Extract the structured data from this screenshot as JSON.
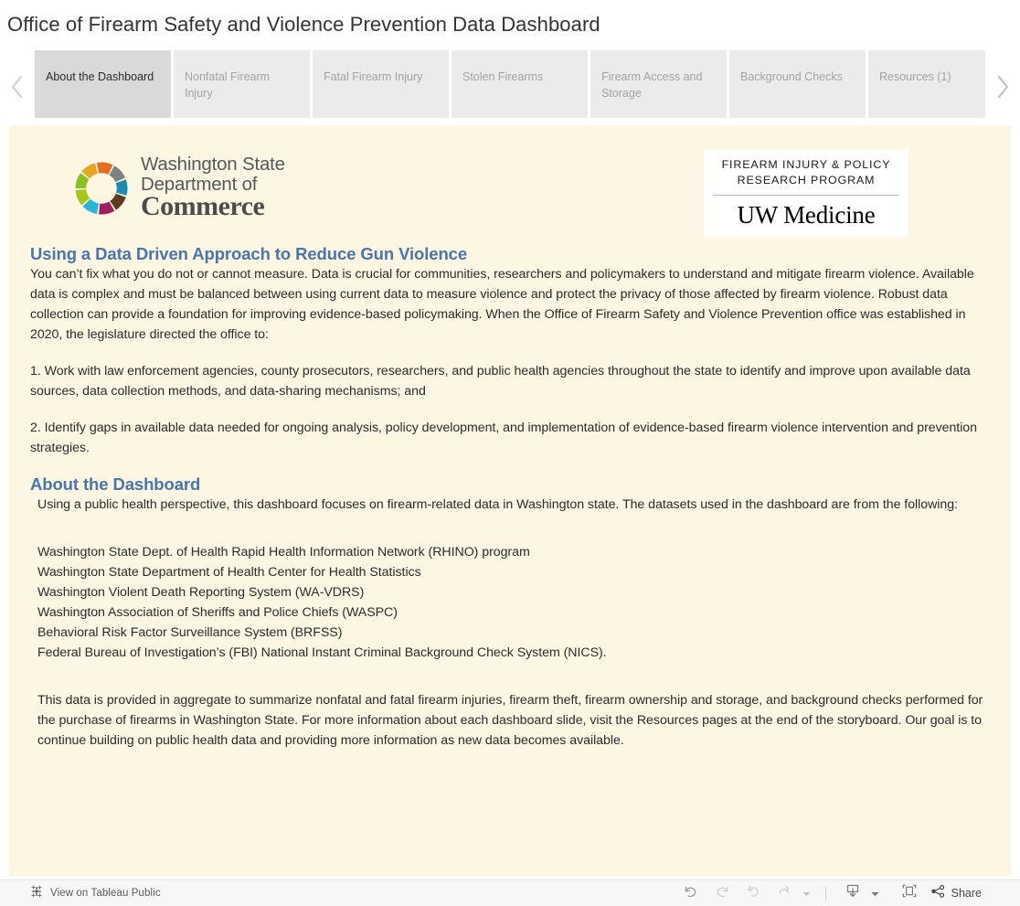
{
  "header": {
    "title": "Office of Firearm Safety and Violence Prevention Data Dashboard"
  },
  "tabstrip": {
    "prev_icon": "chevron-left-icon",
    "next_icon": "chevron-right-icon",
    "tabs": [
      {
        "label": "About the Dashboard",
        "active": true
      },
      {
        "label": "Nonfatal Firearm Injury",
        "active": false
      },
      {
        "label": "Fatal Firearm Injury",
        "active": false
      },
      {
        "label": "Stolen Firearms",
        "active": false
      },
      {
        "label": "Firearm Access and Storage",
        "active": false
      },
      {
        "label": "Background Checks",
        "active": false
      },
      {
        "label": "Resources (1)",
        "active": false
      }
    ]
  },
  "logos": {
    "commerce": {
      "icon": "commerce-pinwheel-logo",
      "line1": "Washington State",
      "line2": "Department of",
      "line3": "Commerce",
      "colors": [
        "#a8c61c",
        "#e2a71e",
        "#ea6a1c",
        "#7f8285",
        "#1b8cad",
        "#5b3a1e",
        "#a01b62",
        "#29b6d8",
        "#8cbf26"
      ]
    },
    "uw": {
      "top_line1": "FIREARM INJURY & POLICY",
      "top_line2": "RESEARCH PROGRAM",
      "bottom": "UW Medicine"
    }
  },
  "main": {
    "heading": "Using a Data Driven Approach to Reduce Gun Violence",
    "intro": "You can’t fix what you do not or cannot measure. Data is crucial for communities, researchers and policymakers to understand and mitigate firearm violence. Available data is complex and must be balanced between using current data to measure violence and protect the privacy of those affected by firearm violence. Robust data collection can provide a foundation for improving evidence-based policymaking. When the Office of Firearm Safety and Violence Prevention office was established in 2020, the legislature directed the office to:",
    "directive_1": "1. Work with law enforcement agencies, county prosecutors, researchers, and public health agencies throughout the state to identify and improve upon available data sources, data collection methods, and data-sharing mechanisms; and",
    "directive_2": "2. Identify gaps in available data needed for ongoing analysis, policy development, and implementation of evidence-based firearm violence intervention and prevention strategies.",
    "about_heading": "About the Dashboard",
    "about_intro": "Using a public health perspective, this dashboard focuses on firearm-related data in Washington state. The datasets used in the dashboard are from the following:",
    "sources": [
      "Washington State Dept. of Health Rapid Health Information Network (RHINO) program",
      "Washington State Department of Health Center for Health Statistics",
      "Washington Violent Death Reporting System (WA-VDRS)",
      "Washington Association of Sheriffs and Police Chiefs (WASPC)",
      "Behavioral Risk Factor Surveillance System (BRFSS)",
      "Federal Bureau of Investigation’s (FBI) National Instant Criminal Background Check System (NICS)."
    ],
    "closing": "This data is provided in aggregate to summarize nonfatal and fatal firearm injuries, firearm theft, firearm ownership and storage, and background checks performed for the purchase of firearms in Washington State. For more information about each dashboard slide, visit the Resources pages at the end of the storyboard. Our goal is to continue building on public health data and providing more information as new data becomes available."
  },
  "footer": {
    "view_label": "View on Tableau Public",
    "tableau_icon": "tableau-logo-icon",
    "share_label": "Share",
    "buttons": [
      {
        "name": "undo-button",
        "icon": "undo-icon"
      },
      {
        "name": "redo-button",
        "icon": "redo-icon"
      },
      {
        "name": "revert-button",
        "icon": "revert-icon"
      },
      {
        "name": "refresh-button",
        "icon": "refresh-icon"
      },
      {
        "name": "refresh-dropdown",
        "icon": "caret-down-icon"
      },
      {
        "name": "download-button",
        "icon": "download-icon"
      },
      {
        "name": "download-dropdown",
        "icon": "caret-down-icon"
      },
      {
        "name": "fullscreen-button",
        "icon": "fullscreen-icon"
      },
      {
        "name": "share-button",
        "icon": "share-icon"
      }
    ]
  },
  "colors": {
    "panel_background": "#fdf6e3",
    "heading_blue": "#4a76a8",
    "tab_active": "#d9d9d9",
    "tab_inactive": "#ebebeb"
  }
}
